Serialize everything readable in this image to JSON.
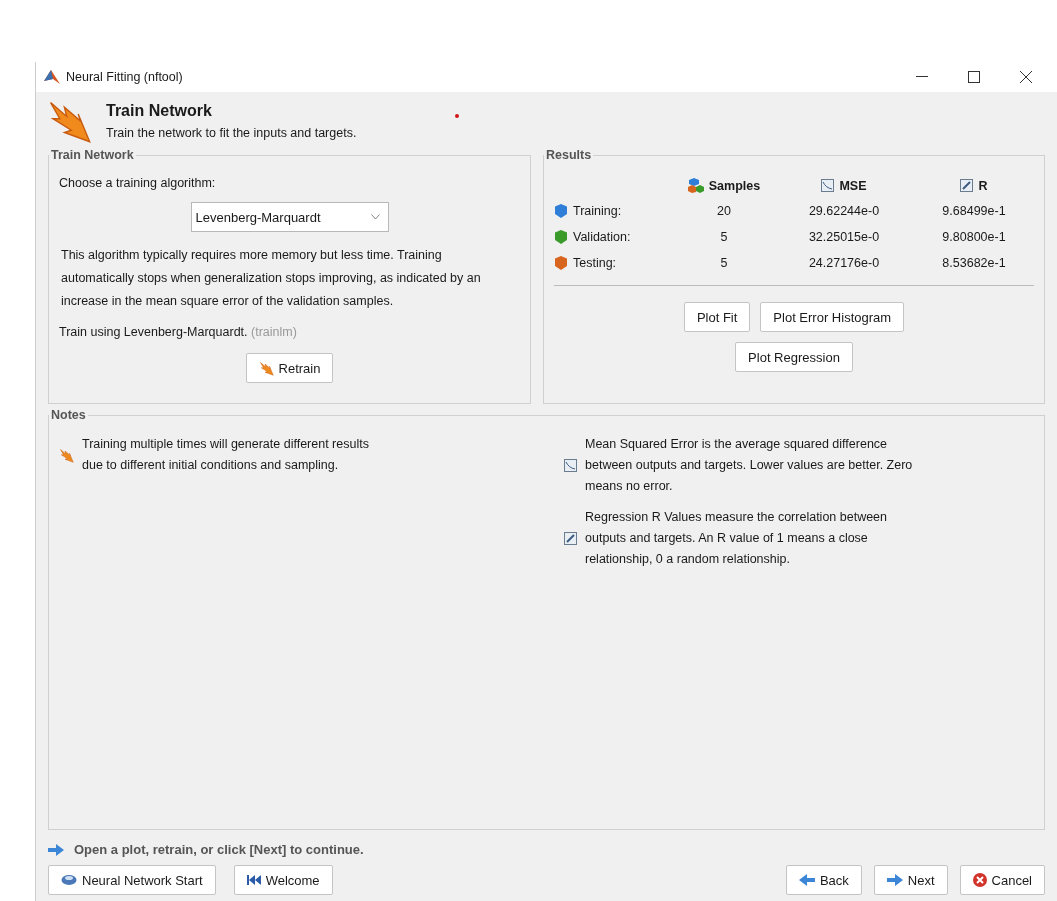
{
  "window": {
    "title": "Neural Fitting (nftool)"
  },
  "header": {
    "title": "Train Network",
    "subtitle": "Train the network to fit the inputs and targets."
  },
  "train_panel": {
    "title": "Train Network",
    "prompt": "Choose a training algorithm:",
    "algorithm": "Levenberg-Marquardt",
    "description": "This algorithm typically requires more memory but less time. Training automatically stops when generalization stops improving, as indicated by an increase in the mean square error of the validation samples.",
    "using": "Train using Levenberg-Marquardt.",
    "using_code": "(trainlm)",
    "retrain": "Retrain"
  },
  "results": {
    "title": "Results",
    "columns": [
      {
        "label": "Samples",
        "kind": "samples"
      },
      {
        "label": "MSE",
        "kind": "mse"
      },
      {
        "label": "R",
        "kind": "r"
      }
    ],
    "rows": [
      {
        "label": "Training:",
        "color": "#2f7fd8",
        "samples": "20",
        "mse": "29.62244e-0",
        "r": "9.68499e-1"
      },
      {
        "label": "Validation:",
        "color": "#3a9a2a",
        "samples": "5",
        "mse": "32.25015e-0",
        "r": "9.80800e-1"
      },
      {
        "label": "Testing:",
        "color": "#d8651e",
        "samples": "5",
        "mse": "24.27176e-0",
        "r": "8.53682e-1"
      }
    ],
    "buttons": [
      [
        "Plot Fit",
        "Plot Error Histogram"
      ],
      [
        "Plot Regression"
      ]
    ]
  },
  "notes": {
    "title": "Notes",
    "items": [
      {
        "kind": "retrain",
        "text": "Training multiple times will generate different results due to different initial conditions and sampling."
      },
      {
        "kind": "mse",
        "text": "Mean Squared Error is the average squared difference between outputs and targets. Lower values are better. Zero means no error."
      },
      {
        "kind": "r",
        "text": "Regression R Values measure the correlation between outputs and targets. An R value of 1 means a close relationship, 0 a random relationship."
      }
    ]
  },
  "footer": {
    "prompt": "Open a plot, retrain, or click [Next] to continue.",
    "left_buttons": [
      {
        "kind": "start",
        "label": "Neural Network Start"
      },
      {
        "kind": "welcome",
        "label": "Welcome"
      }
    ],
    "right_buttons": [
      {
        "kind": "back",
        "label": "Back"
      },
      {
        "kind": "next",
        "label": "Next"
      },
      {
        "kind": "cancel",
        "label": "Cancel"
      }
    ]
  }
}
